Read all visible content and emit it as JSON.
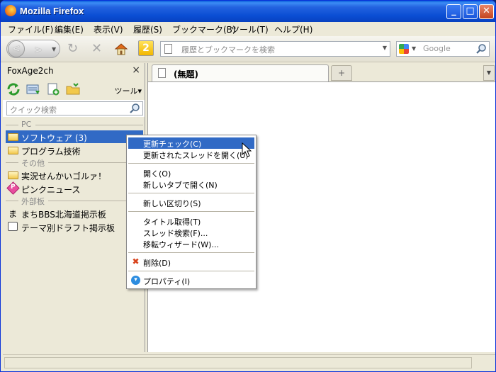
{
  "window": {
    "title": "Mozilla Firefox",
    "controls": {
      "minimize": "_",
      "maximize": "□",
      "close": "✕"
    }
  },
  "menubar": [
    "ファイル(F)",
    "編集(E)",
    "表示(V)",
    "履歴(S)",
    "ブックマーク(B)",
    "ツール(T)",
    "ヘルプ(H)"
  ],
  "navbar": {
    "back_glyph": "<",
    "forward_glyph": ">",
    "reload_glyph": "↻",
    "stop_glyph": "✕",
    "sidebar_toggle_label": "2",
    "url_placeholder": "履歴とブックマークを検索",
    "search_placeholder": "Google"
  },
  "sidebar": {
    "title": "FoxAge2ch",
    "close_glyph": "×",
    "tools_label": "ツール▾",
    "quick_search_placeholder": "クイック検索",
    "sections": [
      {
        "label": "PC"
      },
      {
        "label": "その他"
      },
      {
        "label": "外部板"
      }
    ],
    "items": [
      {
        "label": "ソフトウェア (3)",
        "icon": "folder-icon",
        "selected": true
      },
      {
        "label": "プログラム技術",
        "icon": "folder-icon",
        "selected": false
      },
      {
        "label": "実況せんかいゴルァ！",
        "icon": "folder-icon",
        "selected": false
      },
      {
        "label": "ピンクニュース",
        "icon": "pink-board-icon",
        "selected": false
      },
      {
        "label": "まちBBS北海道掲示板",
        "icon": "ma-board-icon",
        "selected": false
      },
      {
        "label": "テーマ別ドラフト掲示板",
        "icon": "board-icon",
        "selected": false
      }
    ],
    "ma_glyph": "ま",
    "pink_glyph": "P"
  },
  "tabs": [
    {
      "label": "(無題)"
    }
  ],
  "newtab_glyph": "+",
  "context_menu": {
    "groups": [
      [
        "更新チェック(C)",
        "更新されたスレッドを開く(U)"
      ],
      [
        "開く(O)",
        "新しいタブで開く(N)"
      ],
      [
        "新しい区切り(S)"
      ],
      [
        "タイトル取得(T)",
        "スレッド検索(F)...",
        "移転ウィザード(W)..."
      ],
      [
        "削除(D)"
      ],
      [
        "プロパティ(I)"
      ]
    ],
    "highlighted": "更新チェック(C)",
    "delete_glyph": "✖",
    "properties_glyph": "▾"
  },
  "colors": {
    "selection": "#316ac5",
    "titlebar": "#0a4ed4",
    "chrome": "#ece9d8"
  }
}
